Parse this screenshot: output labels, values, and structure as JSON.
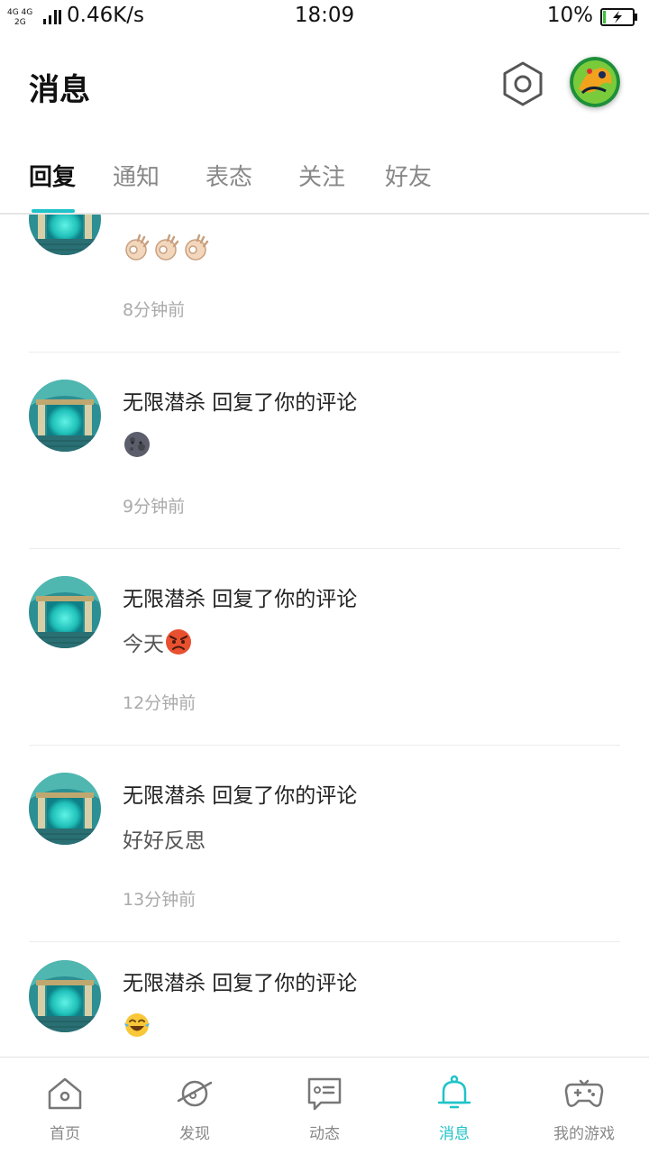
{
  "status_bar": {
    "network_top": "4G 4G",
    "network_bottom": "2G",
    "speed": "0.46K/s",
    "time": "18:09",
    "battery_percent": "10%",
    "battery_level": 0.1
  },
  "header": {
    "title": "消息",
    "settings_icon": "hexagon-gear-icon",
    "avatar_icon": "user-avatar"
  },
  "tabs": [
    {
      "label": "回复",
      "active": true
    },
    {
      "label": "通知",
      "active": false
    },
    {
      "label": "表态",
      "active": false
    },
    {
      "label": "关注",
      "active": false
    },
    {
      "label": "好友",
      "active": false
    }
  ],
  "messages": [
    {
      "title": "",
      "content_text": "",
      "emoji": "ok-hand-x3",
      "time": "8分钟前"
    },
    {
      "title": "无限潜杀 回复了你的评论",
      "content_text": "",
      "emoji": "new-moon-face",
      "time": "9分钟前"
    },
    {
      "title": "无限潜杀 回复了你的评论",
      "content_text": "今天",
      "emoji": "angry-face",
      "time": "12分钟前"
    },
    {
      "title": "无限潜杀 回复了你的评论",
      "content_text": "好好反思",
      "emoji": "",
      "time": "13分钟前"
    },
    {
      "title": "无限潜杀 回复了你的评论",
      "content_text": "",
      "emoji": "tears-of-joy-face",
      "time": ""
    }
  ],
  "bottom_nav": [
    {
      "label": "首页",
      "icon": "home-icon",
      "active": false
    },
    {
      "label": "发现",
      "icon": "planet-icon",
      "active": false
    },
    {
      "label": "动态",
      "icon": "chat-list-icon",
      "active": false
    },
    {
      "label": "消息",
      "icon": "bell-icon",
      "active": true
    },
    {
      "label": "我的游戏",
      "icon": "gamepad-icon",
      "active": false
    }
  ],
  "colors": {
    "accent": "#1fc3c8",
    "text_primary": "#222222",
    "text_secondary": "#888888",
    "divider": "#ececec"
  }
}
